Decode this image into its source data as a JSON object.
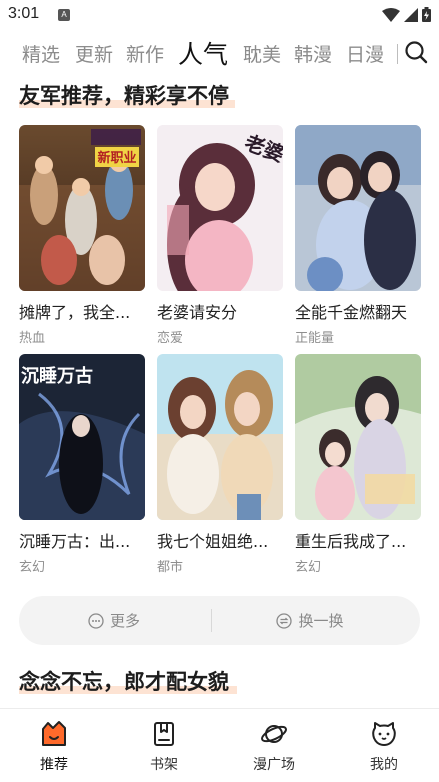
{
  "status_bar": {
    "time": "3:01",
    "app_icon": "A"
  },
  "top_tabs": [
    {
      "label": "精选"
    },
    {
      "label": "更新"
    },
    {
      "label": "新作"
    },
    {
      "label": "人气",
      "active": true
    },
    {
      "label": "耽美"
    },
    {
      "label": "韩漫"
    },
    {
      "label": "日漫"
    }
  ],
  "sections": [
    {
      "title": "友军推荐，精彩享不停",
      "comics": [
        {
          "title": "摊牌了，我全职业系统！",
          "display_title": "摊牌了，我全...",
          "tag": "热血",
          "cover_text": "新职业"
        },
        {
          "title": "老婆请安分",
          "display_title": "老婆请安分",
          "tag": "恋爱",
          "cover_text": "老婆"
        },
        {
          "title": "全能千金燃翻天",
          "display_title": "全能千金燃翻天",
          "tag": "正能量",
          "cover_text": ""
        },
        {
          "title": "沉睡万古：出...",
          "display_title": "沉睡万古：出...",
          "tag": "玄幻",
          "cover_text": "沉睡万古"
        },
        {
          "title": "我七个姐姐绝...",
          "display_title": "我七个姐姐绝...",
          "tag": "都市",
          "cover_text": ""
        },
        {
          "title": "重生后我成了...",
          "display_title": "重生后我成了...",
          "tag": "玄幻",
          "cover_text": ""
        }
      ],
      "more_label": "更多",
      "refresh_label": "换一换"
    },
    {
      "title": "念念不忘，郎才配女貌"
    }
  ],
  "bottom_nav": [
    {
      "label": "推荐",
      "icon": "recommend-icon",
      "active": true
    },
    {
      "label": "书架",
      "icon": "bookshelf-icon"
    },
    {
      "label": "漫广场",
      "icon": "planet-icon"
    },
    {
      "label": "我的",
      "icon": "profile-icon"
    }
  ],
  "colors": {
    "accent": "#ff6a2b",
    "highlight": "#fde3d3",
    "muted": "#8c8c8c"
  }
}
